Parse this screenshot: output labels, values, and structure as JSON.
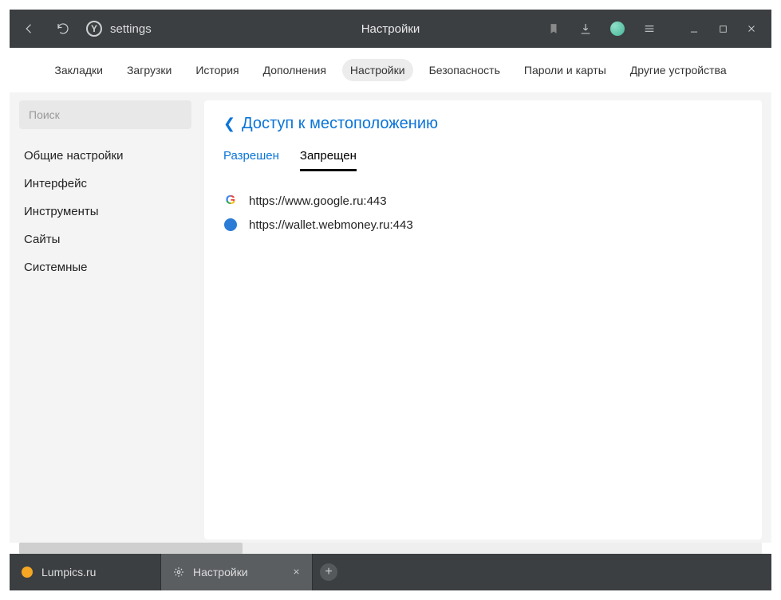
{
  "titlebar": {
    "url_text": "settings",
    "page_title": "Настройки"
  },
  "topnav": {
    "items": [
      {
        "label": "Закладки"
      },
      {
        "label": "Загрузки"
      },
      {
        "label": "История"
      },
      {
        "label": "Дополнения"
      },
      {
        "label": "Настройки"
      },
      {
        "label": "Безопасность"
      },
      {
        "label": "Пароли и карты"
      },
      {
        "label": "Другие устройства"
      }
    ],
    "active_index": 4
  },
  "sidebar": {
    "search_placeholder": "Поиск",
    "items": [
      {
        "label": "Общие настройки"
      },
      {
        "label": "Интерфейс"
      },
      {
        "label": "Инструменты"
      },
      {
        "label": "Сайты"
      },
      {
        "label": "Системные"
      }
    ]
  },
  "panel": {
    "title": "Доступ к местоположению",
    "subtabs": [
      {
        "label": "Разрешен"
      },
      {
        "label": "Запрещен"
      }
    ],
    "active_subtab": 1,
    "sites": [
      {
        "icon": "google",
        "url": "https://www.google.ru:443"
      },
      {
        "icon": "globe",
        "url": "https://wallet.webmoney.ru:443"
      }
    ]
  },
  "tabs": {
    "items": [
      {
        "favicon": "orange",
        "label": "Lumpics.ru"
      },
      {
        "favicon": "gear",
        "label": "Настройки"
      }
    ],
    "active_index": 1
  }
}
